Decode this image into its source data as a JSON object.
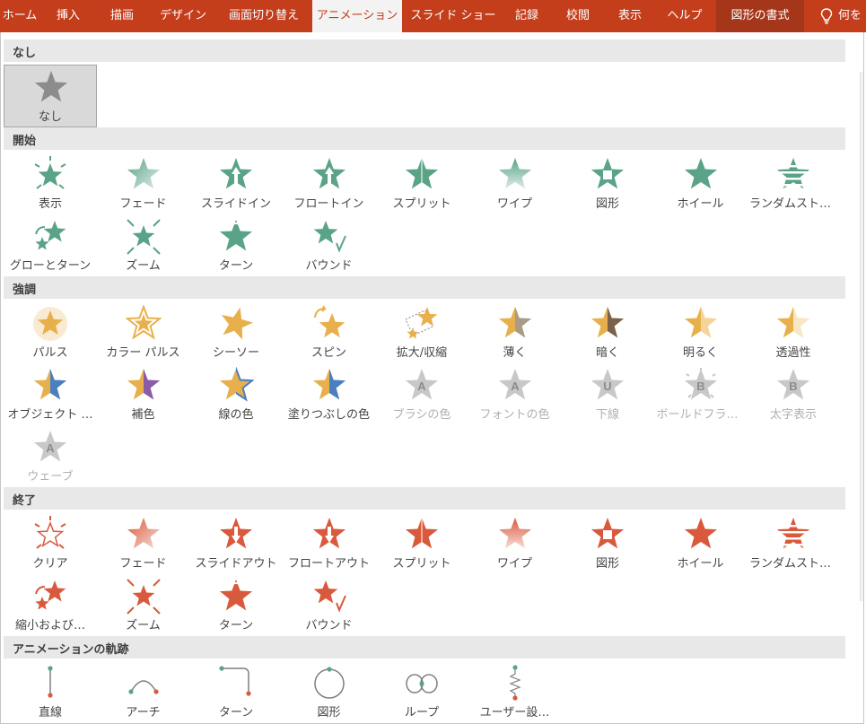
{
  "ribbon": {
    "tabs": [
      {
        "label": "ホーム",
        "state": "normal"
      },
      {
        "label": "挿入",
        "state": "normal"
      },
      {
        "label": "描画",
        "state": "normal"
      },
      {
        "label": "デザイン",
        "state": "normal"
      },
      {
        "label": "画面切り替え",
        "state": "normal"
      },
      {
        "label": "アニメーション",
        "state": "active"
      },
      {
        "label": "スライド ショー",
        "state": "normal"
      },
      {
        "label": "記録",
        "state": "normal"
      },
      {
        "label": "校閲",
        "state": "normal"
      },
      {
        "label": "表示",
        "state": "normal"
      },
      {
        "label": "ヘルプ",
        "state": "normal"
      },
      {
        "label": "図形の書式",
        "state": "contextual"
      }
    ],
    "search_label": "何を"
  },
  "colors": {
    "ribbon": "#c43e1c",
    "entrance": "#5aa386",
    "emphasis": "#e8b04c",
    "exit": "#d9593c",
    "disabled": "#c8c8c8",
    "path_line": "#7f7f7f",
    "path_start": "#5aa386",
    "path_end": "#d9593c"
  },
  "gallery": {
    "sections": [
      {
        "key": "none",
        "title": "なし",
        "items": [
          {
            "label": "なし",
            "icon": "star-none-icon",
            "selected": true
          }
        ]
      },
      {
        "key": "entrance",
        "title": "開始",
        "items": [
          {
            "label": "表示",
            "icon": "appear-icon"
          },
          {
            "label": "フェード",
            "icon": "fade-icon"
          },
          {
            "label": "スライドイン",
            "icon": "fly-in-icon"
          },
          {
            "label": "フロートイン",
            "icon": "float-in-icon"
          },
          {
            "label": "スプリット",
            "icon": "split-icon"
          },
          {
            "label": "ワイプ",
            "icon": "wipe-icon"
          },
          {
            "label": "図形",
            "icon": "shape-icon"
          },
          {
            "label": "ホイール",
            "icon": "wheel-icon"
          },
          {
            "label": "ランダムストラ…",
            "icon": "random-bars-icon"
          },
          {
            "label": "グローとターン",
            "icon": "grow-turn-icon"
          },
          {
            "label": "ズーム",
            "icon": "zoom-icon"
          },
          {
            "label": "ターン",
            "icon": "swivel-icon"
          },
          {
            "label": "バウンド",
            "icon": "bounce-icon"
          }
        ]
      },
      {
        "key": "emphasis",
        "title": "強調",
        "items": [
          {
            "label": "パルス",
            "icon": "pulse-icon"
          },
          {
            "label": "カラー パルス",
            "icon": "color-pulse-icon"
          },
          {
            "label": "シーソー",
            "icon": "teeter-icon"
          },
          {
            "label": "スピン",
            "icon": "spin-icon"
          },
          {
            "label": "拡大/収縮",
            "icon": "grow-shrink-icon"
          },
          {
            "label": "薄く",
            "icon": "desaturate-icon"
          },
          {
            "label": "暗く",
            "icon": "darken-icon"
          },
          {
            "label": "明るく",
            "icon": "lighten-icon"
          },
          {
            "label": "透過性",
            "icon": "transparency-icon"
          },
          {
            "label": "オブジェクト …",
            "icon": "object-color-icon"
          },
          {
            "label": "補色",
            "icon": "complementary-color-icon"
          },
          {
            "label": "線の色",
            "icon": "line-color-icon"
          },
          {
            "label": "塗りつぶしの色",
            "icon": "fill-color-icon"
          },
          {
            "label": "ブラシの色",
            "icon": "brush-color-icon",
            "disabled": true,
            "letter": "A"
          },
          {
            "label": "フォントの色",
            "icon": "font-color-icon",
            "disabled": true,
            "letter": "A"
          },
          {
            "label": "下線",
            "icon": "underline-icon",
            "disabled": true,
            "letter": "U"
          },
          {
            "label": "ボールドフラッ…",
            "icon": "bold-flash-icon",
            "disabled": true,
            "letter": "B"
          },
          {
            "label": "太字表示",
            "icon": "bold-reveal-icon",
            "disabled": true,
            "letter": "B"
          },
          {
            "label": "ウェーブ",
            "icon": "wave-icon",
            "disabled": true,
            "letter": "A"
          }
        ]
      },
      {
        "key": "exit",
        "title": "終了",
        "items": [
          {
            "label": "クリア",
            "icon": "disappear-icon"
          },
          {
            "label": "フェード",
            "icon": "fade-icon"
          },
          {
            "label": "スライドアウト",
            "icon": "fly-out-icon"
          },
          {
            "label": "フロートアウト",
            "icon": "float-out-icon"
          },
          {
            "label": "スプリット",
            "icon": "split-icon"
          },
          {
            "label": "ワイプ",
            "icon": "wipe-icon"
          },
          {
            "label": "図形",
            "icon": "shape-icon"
          },
          {
            "label": "ホイール",
            "icon": "wheel-icon"
          },
          {
            "label": "ランダムストラ…",
            "icon": "random-bars-icon"
          },
          {
            "label": "縮小および…",
            "icon": "shrink-turn-icon"
          },
          {
            "label": "ズーム",
            "icon": "zoom-icon"
          },
          {
            "label": "ターン",
            "icon": "swivel-icon"
          },
          {
            "label": "バウンド",
            "icon": "bounce-icon"
          }
        ]
      },
      {
        "key": "path",
        "title": "アニメーションの軌跡",
        "items": [
          {
            "label": "直線",
            "icon": "path-line-icon"
          },
          {
            "label": "アーチ",
            "icon": "path-arc-icon"
          },
          {
            "label": "ターン",
            "icon": "path-turn-icon"
          },
          {
            "label": "図形",
            "icon": "path-shape-icon"
          },
          {
            "label": "ループ",
            "icon": "path-loop-icon"
          },
          {
            "label": "ユーザー設…",
            "icon": "path-custom-icon"
          }
        ]
      }
    ]
  }
}
